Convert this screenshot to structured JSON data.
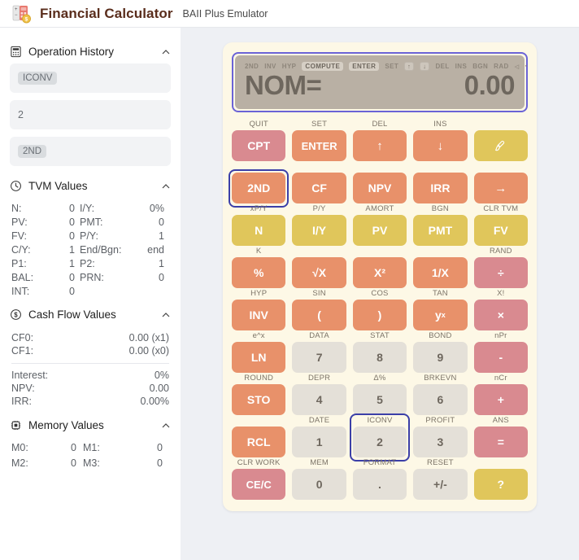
{
  "header": {
    "icon": "calculator-coin-icon",
    "title": "Financial Calculator",
    "subtitle": "BAII Plus Emulator"
  },
  "sidebar": {
    "sections": [
      {
        "id": "operation-history",
        "icon": "calculator-icon",
        "title": "Operation History",
        "chevron": "chevron-up-icon"
      },
      {
        "id": "tvm-values",
        "icon": "clock-icon",
        "title": "TVM Values",
        "chevron": "chevron-up-icon"
      },
      {
        "id": "cash-flow-values",
        "icon": "dollar-circle-icon",
        "title": "Cash Flow Values",
        "chevron": "chevron-up-icon"
      },
      {
        "id": "memory-values",
        "icon": "memory-chip-icon",
        "title": "Memory Values",
        "chevron": "chevron-up-icon"
      }
    ],
    "history": [
      {
        "text": "ICONV",
        "style": "chip"
      },
      {
        "text": "2",
        "style": "plain"
      },
      {
        "text": "2ND",
        "style": "chip"
      }
    ],
    "tvm": [
      {
        "k1": "N:",
        "v1": "0",
        "k2": "I/Y:",
        "v2": "0%"
      },
      {
        "k1": "PV:",
        "v1": "0",
        "k2": "PMT:",
        "v2": "0"
      },
      {
        "k1": "FV:",
        "v1": "0",
        "k2": "P/Y:",
        "v2": "1"
      },
      {
        "k1": "C/Y:",
        "v1": "1",
        "k2": "End/Bgn:",
        "v2": "end"
      },
      {
        "k1": "P1:",
        "v1": "1",
        "k2": "P2:",
        "v2": "1"
      },
      {
        "k1": "BAL:",
        "v1": "0",
        "k2": "PRN:",
        "v2": "0"
      },
      {
        "k1": "INT:",
        "v1": "0",
        "k2": "",
        "v2": ""
      }
    ],
    "cashflow_top": [
      {
        "k": "CF0:",
        "v": "0.00 (x1)"
      },
      {
        "k": "CF1:",
        "v": "0.00 (x0)"
      }
    ],
    "cashflow_bottom": [
      {
        "k": "Interest:",
        "v": "0%"
      },
      {
        "k": "NPV:",
        "v": "0.00"
      },
      {
        "k": "IRR:",
        "v": "0.00%"
      }
    ],
    "memory": [
      {
        "k1": "M0:",
        "v1": "0",
        "k2": "M1:",
        "v2": "0"
      },
      {
        "k1": "M2:",
        "v1": "0",
        "k2": "M3:",
        "v2": "0"
      }
    ]
  },
  "calculator": {
    "display": {
      "indicators": [
        {
          "label": "2ND",
          "state": "off"
        },
        {
          "label": "INV",
          "state": "off"
        },
        {
          "label": "HYP",
          "state": "off"
        },
        {
          "label": "COMPUTE",
          "state": "on"
        },
        {
          "label": "ENTER",
          "state": "on"
        },
        {
          "label": "SET",
          "state": "off"
        },
        {
          "label": "↑",
          "state": "box"
        },
        {
          "label": "↓",
          "state": "box"
        },
        {
          "label": "DEL",
          "state": "off"
        },
        {
          "label": "INS",
          "state": "off"
        },
        {
          "label": "BGN",
          "state": "off"
        },
        {
          "label": "RAD",
          "state": "off"
        },
        {
          "label": "◁",
          "state": "tiny"
        },
        {
          "label": "▪",
          "state": "tiny"
        }
      ],
      "left_text": "NOM=",
      "right_text": "0.00"
    },
    "rows": [
      {
        "keys": [
          {
            "label": "QUIT",
            "key": "CPT",
            "color": "rose",
            "selected": false
          },
          {
            "label": "SET",
            "key": "ENTER",
            "color": "orange",
            "selected": false
          },
          {
            "label": "DEL",
            "key": "↑",
            "color": "orange",
            "selected": false
          },
          {
            "label": "INS",
            "key": "↓",
            "color": "orange",
            "selected": false
          },
          {
            "label": "",
            "key": "brush-icon",
            "color": "gold",
            "selected": false
          }
        ]
      },
      {
        "keys": [
          {
            "label": "",
            "key": "2ND",
            "color": "orange",
            "selected": true
          },
          {
            "label": "",
            "key": "CF",
            "color": "orange",
            "selected": false
          },
          {
            "label": "",
            "key": "NPV",
            "color": "orange",
            "selected": false
          },
          {
            "label": "",
            "key": "IRR",
            "color": "orange",
            "selected": false
          },
          {
            "label": "",
            "key": "→",
            "color": "orange",
            "selected": false
          }
        ]
      },
      {
        "keys": [
          {
            "label": "xP/Y",
            "key": "N",
            "color": "gold",
            "selected": false
          },
          {
            "label": "P/Y",
            "key": "I/Y",
            "color": "gold",
            "selected": false
          },
          {
            "label": "AMORT",
            "key": "PV",
            "color": "gold",
            "selected": false
          },
          {
            "label": "BGN",
            "key": "PMT",
            "color": "gold",
            "selected": false
          },
          {
            "label": "CLR TVM",
            "key": "FV",
            "color": "gold",
            "selected": false
          }
        ]
      },
      {
        "keys": [
          {
            "label": "K",
            "key": "%",
            "color": "orange",
            "selected": false
          },
          {
            "label": "",
            "key": "√X",
            "color": "orange",
            "selected": false
          },
          {
            "label": "",
            "key": "X²",
            "color": "orange",
            "selected": false
          },
          {
            "label": "",
            "key": "1/X",
            "color": "orange",
            "selected": false
          },
          {
            "label": "RAND",
            "key": "÷",
            "color": "rose",
            "selected": false
          }
        ]
      },
      {
        "keys": [
          {
            "label": "HYP",
            "key": "INV",
            "color": "orange",
            "selected": false
          },
          {
            "label": "SIN",
            "key": "(",
            "color": "orange",
            "selected": false
          },
          {
            "label": "COS",
            "key": ")",
            "color": "orange",
            "selected": false
          },
          {
            "label": "TAN",
            "key": "y^x",
            "color": "orange",
            "selected": false
          },
          {
            "label": "X!",
            "key": "×",
            "color": "rose",
            "selected": false
          }
        ]
      },
      {
        "keys": [
          {
            "label": "e^x",
            "key": "LN",
            "color": "orange",
            "selected": false
          },
          {
            "label": "DATA",
            "key": "7",
            "color": "gray",
            "selected": false
          },
          {
            "label": "STAT",
            "key": "8",
            "color": "gray",
            "selected": false
          },
          {
            "label": "BOND",
            "key": "9",
            "color": "gray",
            "selected": false
          },
          {
            "label": "nPr",
            "key": "-",
            "color": "rose",
            "selected": false
          }
        ]
      },
      {
        "keys": [
          {
            "label": "ROUND",
            "key": "STO",
            "color": "orange",
            "selected": false
          },
          {
            "label": "DEPR",
            "key": "4",
            "color": "gray",
            "selected": false
          },
          {
            "label": "Δ%",
            "key": "5",
            "color": "gray",
            "selected": false
          },
          {
            "label": "BRKEVN",
            "key": "6",
            "color": "gray",
            "selected": false
          },
          {
            "label": "nCr",
            "key": "+",
            "color": "rose",
            "selected": false
          }
        ]
      },
      {
        "keys": [
          {
            "label": "",
            "key": "RCL",
            "color": "orange",
            "selected": false
          },
          {
            "label": "DATE",
            "key": "1",
            "color": "gray",
            "selected": false
          },
          {
            "label": "ICONV",
            "key": "2",
            "color": "gray",
            "selected": true
          },
          {
            "label": "PROFIT",
            "key": "3",
            "color": "gray",
            "selected": false
          },
          {
            "label": "ANS",
            "key": "=",
            "color": "rose",
            "selected": false
          }
        ]
      },
      {
        "keys": [
          {
            "label": "CLR WORK",
            "key": "CE/C",
            "color": "rose",
            "selected": false
          },
          {
            "label": "MEM",
            "key": "0",
            "color": "gray",
            "selected": false
          },
          {
            "label": "FORMAT",
            "key": ".",
            "color": "gray",
            "selected": false
          },
          {
            "label": "RESET",
            "key": "+/-",
            "color": "gray",
            "selected": false
          },
          {
            "label": "",
            "key": "?",
            "color": "gold",
            "selected": false
          }
        ]
      }
    ]
  },
  "colors": {
    "accent_orange": "#e8916a",
    "accent_rose": "#d98a90",
    "accent_gold": "#e0c65b",
    "key_gray": "#e4e0d8",
    "calc_body": "#fdf8e6",
    "display_bg": "#b9b0a4",
    "selection": "#3b3fa8",
    "display_border": "#6b63d6",
    "title": "#5a2d1c"
  }
}
